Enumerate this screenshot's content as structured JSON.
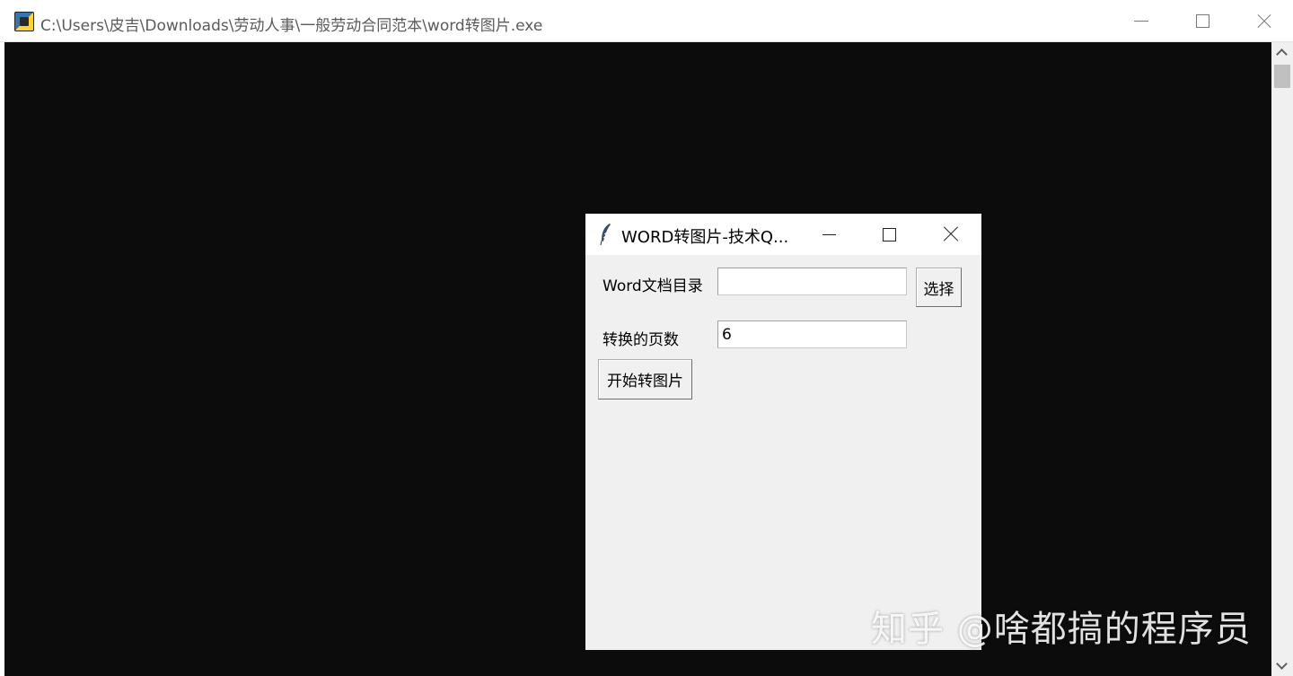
{
  "console": {
    "title": "C:\\Users\\皮吉\\Downloads\\劳动人事\\一般劳动合同范本\\word转图片.exe"
  },
  "dialog": {
    "title": "WORD转图片-技术Q...",
    "dir_label": "Word文档目录",
    "dir_value": "",
    "choose_button": "选择",
    "pages_label": "转换的页数",
    "pages_value": "6",
    "start_button": "开始转图片"
  },
  "watermark": "知乎 @啥都搞的程序员",
  "icons": {
    "console_app": "python-app-icon",
    "dialog_app": "tk-feather-icon"
  }
}
